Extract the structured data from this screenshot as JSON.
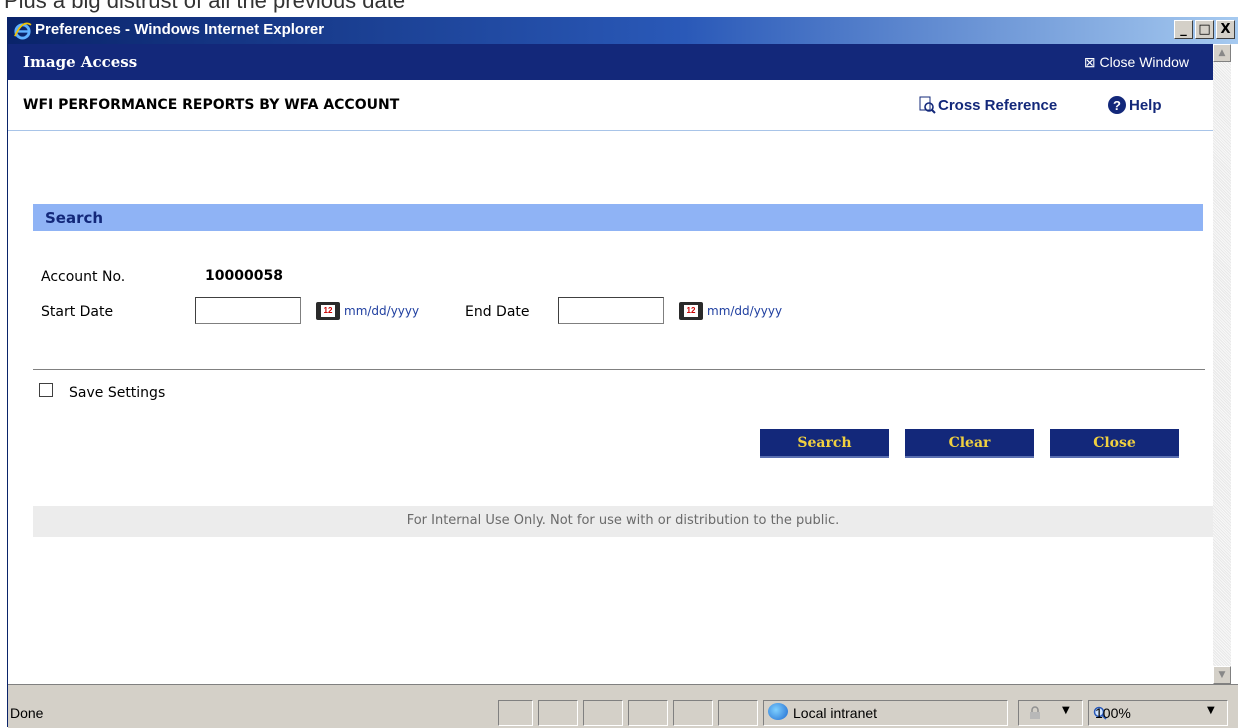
{
  "window": {
    "title": "Preferences - Windows Internet Explorer",
    "controls": {
      "minimize": "_",
      "maximize": "□",
      "close": "X"
    }
  },
  "top_strip_text": "Plus a big distrust of all the previous date",
  "app": {
    "header_title": "Image Access",
    "close_window": "⊠ Close Window"
  },
  "page": {
    "title": "WFI PERFORMANCE REPORTS BY WFA ACCOUNT",
    "cross_reference": "Cross Reference",
    "help": "Help"
  },
  "search": {
    "section_title": "Search",
    "account_label": "Account No.",
    "account_value": "10000058",
    "start_label": "Start Date",
    "start_value": "",
    "start_hint": "mm/dd/yyyy",
    "end_label": "End Date",
    "end_value": "",
    "end_hint": "mm/dd/yyyy",
    "save_settings": "Save Settings",
    "save_settings_checked": false
  },
  "buttons": {
    "search": "Search",
    "clear": "Clear",
    "close": "Close"
  },
  "footer_text": "For Internal Use Only. Not for use with or distribution to the public.",
  "statusbar": {
    "status": "Done",
    "zone": "Local intranet",
    "zoom": "100%"
  },
  "colors": {
    "header_navy": "#13287a",
    "section_bar": "#8fb3f5",
    "button_text": "#f0d040"
  }
}
